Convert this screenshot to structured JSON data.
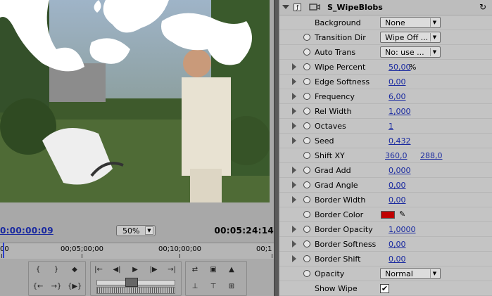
{
  "monitor": {
    "current_timecode": "0:00:00:09",
    "zoom": "50%",
    "duration_timecode": "00:05:24:14",
    "ruler_labels": [
      "00",
      "00;05;00;00",
      "00;10;00;00",
      "00;1"
    ]
  },
  "effect": {
    "title": "S_WipeBlobs",
    "rows": [
      {
        "label": "Background",
        "type": "dropdown",
        "value": "None",
        "twirl": false,
        "keyframe": false
      },
      {
        "label": "Transition Dir",
        "type": "dropdown",
        "value": "Wipe Off ...",
        "twirl": false,
        "keyframe": true
      },
      {
        "label": "Auto Trans",
        "type": "dropdown",
        "value": "No: use ...",
        "twirl": false,
        "keyframe": true
      },
      {
        "label": "Wipe Percent",
        "type": "value",
        "value": "50,00",
        "unit": "%",
        "twirl": true,
        "keyframe": true
      },
      {
        "label": "Edge Softness",
        "type": "value",
        "value": "0,00",
        "twirl": true,
        "keyframe": true
      },
      {
        "label": "Frequency",
        "type": "value",
        "value": "6,00",
        "twirl": true,
        "keyframe": true
      },
      {
        "label": "Rel Width",
        "type": "value",
        "value": "1,000",
        "twirl": true,
        "keyframe": true
      },
      {
        "label": "Octaves",
        "type": "value",
        "value": "1",
        "twirl": true,
        "keyframe": true
      },
      {
        "label": "Seed",
        "type": "value",
        "value": "0,432",
        "twirl": true,
        "keyframe": true
      },
      {
        "label": "Shift XY",
        "type": "pair",
        "value": "360,0",
        "value2": "288,0",
        "twirl": false,
        "keyframe": true
      },
      {
        "label": "Grad Add",
        "type": "value",
        "value": "0,000",
        "twirl": true,
        "keyframe": true
      },
      {
        "label": "Grad Angle",
        "type": "value",
        "value": "0,00",
        "twirl": true,
        "keyframe": true
      },
      {
        "label": "Border Width",
        "type": "value",
        "value": "0,00",
        "twirl": true,
        "keyframe": true
      },
      {
        "label": "Border Color",
        "type": "color",
        "value": "#c00000",
        "twirl": false,
        "keyframe": true
      },
      {
        "label": "Border Opacity",
        "type": "value",
        "value": "1,0000",
        "twirl": true,
        "keyframe": true
      },
      {
        "label": "Border Softness",
        "type": "value",
        "value": "0,00",
        "twirl": true,
        "keyframe": true
      },
      {
        "label": "Border Shift",
        "type": "value",
        "value": "0,00",
        "twirl": true,
        "keyframe": true
      },
      {
        "label": "Opacity",
        "type": "dropdown",
        "value": "Normal",
        "twirl": false,
        "keyframe": true
      },
      {
        "label": "Show Wipe",
        "type": "checkbox",
        "value": "✔",
        "twirl": false,
        "keyframe": false
      }
    ]
  },
  "icons": {
    "reset": "reset-icon",
    "eyedropper": "eyedropper-icon"
  }
}
